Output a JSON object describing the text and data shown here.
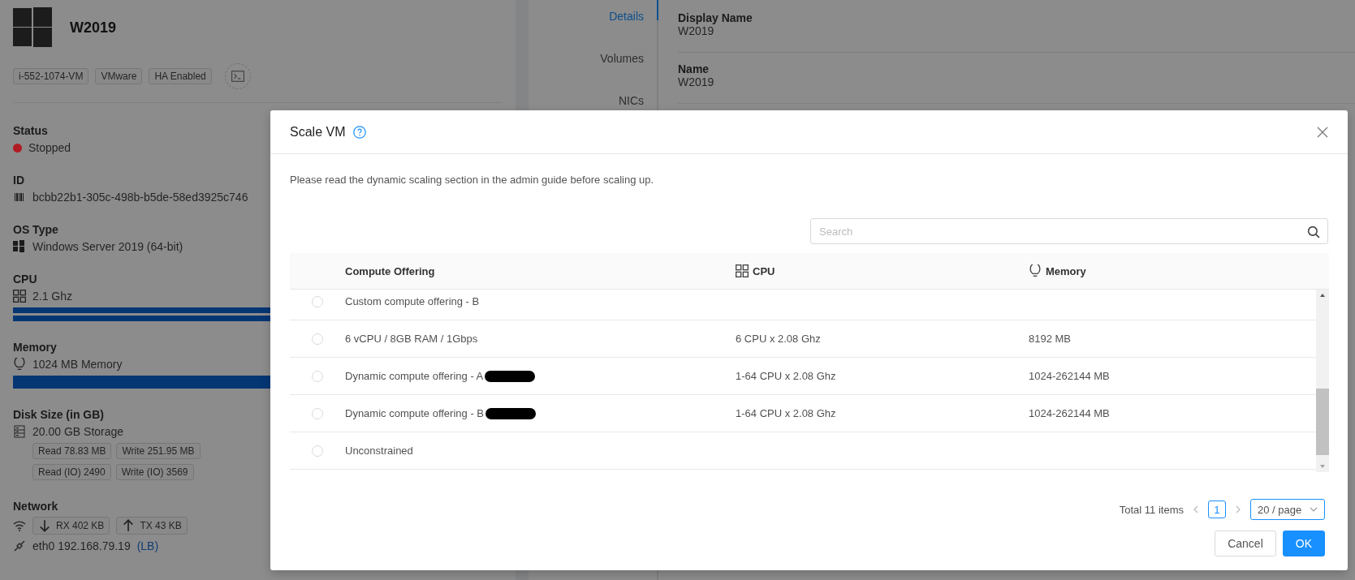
{
  "vm_panel": {
    "name": "W2019",
    "tags": [
      "i-552-1074-VM",
      "VMware",
      "HA Enabled"
    ],
    "sections": [
      {
        "kind": "status",
        "label": "Status",
        "value": "Stopped",
        "color": "#b01c22"
      },
      {
        "kind": "id",
        "label": "ID",
        "value": "bcbb22b1-305c-498b-b5de-58ed3925c746"
      },
      {
        "kind": "os",
        "label": "OS Type",
        "value": "Windows Server 2019 (64-bit)"
      },
      {
        "kind": "cpu",
        "label": "CPU",
        "value": "2.1 Ghz",
        "bars": [
          {
            "level": 1
          },
          {
            "level": 1
          }
        ]
      },
      {
        "kind": "memory",
        "label": "Memory",
        "value": "1024 MB Memory",
        "bars": [
          {
            "level": 1
          }
        ]
      },
      {
        "kind": "disk",
        "label": "Disk Size (in GB)",
        "value": "20.00 GB Storage",
        "stats": [
          "Read 78.83 MB",
          "Write 251.95 MB",
          "Read (IO) 2490",
          "Write (IO) 3569"
        ]
      },
      {
        "kind": "network",
        "label": "Network",
        "traffic": [
          {
            "kind": "download",
            "text": "RX 402 KB"
          },
          {
            "kind": "upload",
            "text": "TX 43 KB"
          }
        ],
        "nic": "eth0 192.168.79.19",
        "nic_link": "(LB)"
      }
    ]
  },
  "tabs": [
    {
      "label": "Details",
      "selected": true
    },
    {
      "label": "Volumes",
      "selected": false
    },
    {
      "label": "NICs",
      "selected": false
    }
  ],
  "fields": [
    {
      "label": "Display Name",
      "value": "W2019"
    },
    {
      "label": "Name",
      "value": "W2019"
    }
  ],
  "dialog": {
    "title": "Scale VM",
    "notice": "Please read the dynamic scaling section in the admin guide before scaling up.",
    "search": {
      "placeholder": "Search"
    },
    "table": {
      "columns": [
        {
          "label": "Compute Offering"
        },
        {
          "label": "CPU"
        },
        {
          "label": "Memory"
        }
      ],
      "rows": [
        {
          "selected": false,
          "offering": "Custom compute offering - B"
        },
        {
          "selected": false,
          "offering": "6 vCPU / 8GB RAM / 1Gbps",
          "cpu": "6 CPU x 2.08 Ghz",
          "memory": "8192 MB"
        },
        {
          "selected": false,
          "offering": "Dynamic compute offering - A",
          "redacted": true,
          "cpu": "1-64 CPU x 2.08 Ghz",
          "memory": "1024-262144 MB"
        },
        {
          "selected": false,
          "offering": "Dynamic compute offering - B",
          "redacted": true,
          "cpu": "1-64 CPU x 2.08 Ghz",
          "memory": "1024-262144 MB"
        },
        {
          "selected": false,
          "offering": "Unconstrained"
        }
      ]
    },
    "pagination": {
      "total": "Total 11 items",
      "pages": [
        {
          "label": "1",
          "selected": true
        }
      ],
      "page_size": "20 / page"
    },
    "buttons": [
      {
        "label": "Cancel",
        "kind": "default"
      },
      {
        "label": "OK",
        "kind": "primary"
      }
    ]
  }
}
